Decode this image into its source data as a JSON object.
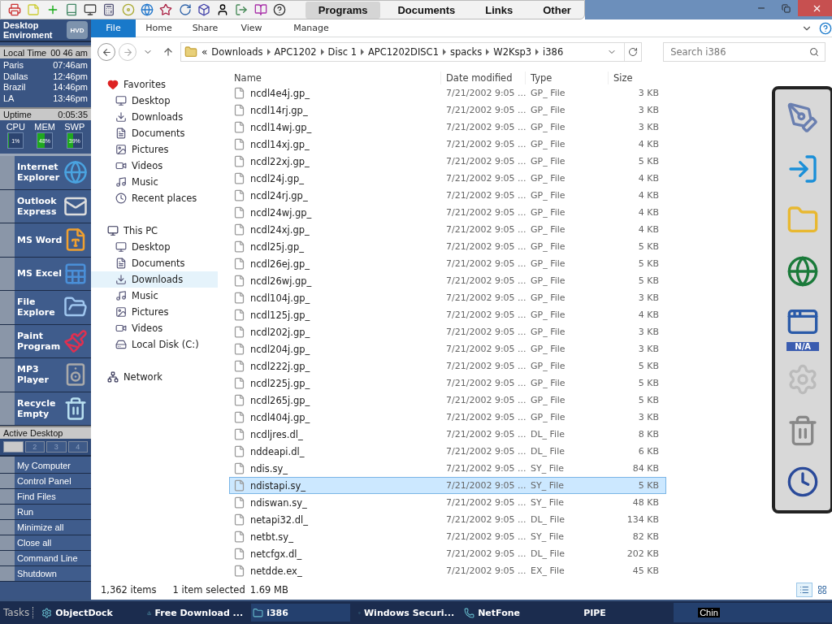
{
  "toolbar": {
    "menu": [
      {
        "label": "Programs",
        "selected": true
      },
      {
        "label": "Documents",
        "selected": false
      },
      {
        "label": "Links",
        "selected": false
      },
      {
        "label": "Other",
        "selected": false
      }
    ]
  },
  "sidebar": {
    "title": "Desktop Enviroment",
    "logo": "HVD",
    "local_time": {
      "label": "Local Time",
      "value": "00 46 am"
    },
    "clocks": [
      {
        "city": "Paris",
        "time": "07:46am"
      },
      {
        "city": "Dallas",
        "time": "12:46pm"
      },
      {
        "city": "Brazil",
        "time": "14:46pm"
      },
      {
        "city": "LA",
        "time": "13:46pm"
      }
    ],
    "uptime": {
      "label": "Uptime",
      "value": "0:05:35"
    },
    "meters": [
      {
        "name": "CPU",
        "reading": "1%",
        "level": 0.01
      },
      {
        "name": "MEM",
        "reading": "48%",
        "level": 0.48
      },
      {
        "name": "SWP",
        "reading": "39%",
        "level": 0.39
      }
    ],
    "launchers": [
      {
        "label": "Internet Explorer"
      },
      {
        "label": "Outlook Express"
      },
      {
        "label": "MS Word"
      },
      {
        "label": "MS Excel"
      },
      {
        "label": "File Explore"
      },
      {
        "label": "Paint Program"
      },
      {
        "label": "MP3 Player"
      },
      {
        "label": "Recycle Empty"
      }
    ],
    "active_desktop": "Active Desktop",
    "pager": [
      {
        "selected": true
      },
      {
        "label": "2",
        "selected": false
      },
      {
        "label": "3",
        "selected": false
      },
      {
        "label": "4",
        "selected": false
      }
    ],
    "menu": [
      "My Computer",
      "Control Panel",
      "Find Files",
      "Run",
      "Minimize all",
      "Close all",
      "Command Line",
      "Shutdown"
    ]
  },
  "ribbon": {
    "tabs": [
      {
        "label": "File",
        "selected": true
      },
      {
        "label": "Home",
        "selected": false
      },
      {
        "label": "Share",
        "selected": false
      },
      {
        "label": "View",
        "selected": false
      },
      {
        "label": "Manage",
        "selected": false
      }
    ]
  },
  "address": {
    "prefix": "«",
    "crumbs": [
      "Downloads",
      "APC1202",
      "Disc 1",
      "APC1202DISC1",
      "spacks",
      "W2Ksp3",
      "i386"
    ],
    "search_placeholder": "Search i386"
  },
  "nav": [
    {
      "label": "Favorites",
      "children": [
        {
          "label": "Desktop",
          "selected": false
        },
        {
          "label": "Downloads",
          "selected": false
        },
        {
          "label": "Documents",
          "selected": false
        },
        {
          "label": "Pictures",
          "selected": false
        },
        {
          "label": "Videos",
          "selected": false
        },
        {
          "label": "Music",
          "selected": false
        },
        {
          "label": "Recent places",
          "selected": false
        }
      ]
    },
    {
      "label": "This PC",
      "children": [
        {
          "label": "Desktop",
          "selected": false
        },
        {
          "label": "Documents",
          "selected": false
        },
        {
          "label": "Downloads",
          "selected": true
        },
        {
          "label": "Music",
          "selected": false
        },
        {
          "label": "Pictures",
          "selected": false
        },
        {
          "label": "Videos",
          "selected": false
        },
        {
          "label": "Local Disk (C:)",
          "selected": false
        }
      ]
    },
    {
      "label": "Network"
    }
  ],
  "table": {
    "columns": [
      "Name",
      "Date modified",
      "Type",
      "Size"
    ],
    "rows": [
      {
        "name": "ncdl4e4j.gp_",
        "date": "7/21/2002 9:05 ...",
        "type": "GP_ File",
        "size": "3 KB",
        "selected": false
      },
      {
        "name": "ncdl14rj.gp_",
        "date": "7/21/2002 9:05 ...",
        "type": "GP_ File",
        "size": "3 KB",
        "selected": false
      },
      {
        "name": "ncdl14wj.gp_",
        "date": "7/21/2002 9:05 ...",
        "type": "GP_ File",
        "size": "3 KB",
        "selected": false
      },
      {
        "name": "ncdl14xj.gp_",
        "date": "7/21/2002 9:05 ...",
        "type": "GP_ File",
        "size": "4 KB",
        "selected": false
      },
      {
        "name": "ncdl22xj.gp_",
        "date": "7/21/2002 9:05 ...",
        "type": "GP_ File",
        "size": "5 KB",
        "selected": false
      },
      {
        "name": "ncdl24j.gp_",
        "date": "7/21/2002 9:05 ...",
        "type": "GP_ File",
        "size": "4 KB",
        "selected": false
      },
      {
        "name": "ncdl24rj.gp_",
        "date": "7/21/2002 9:05 ...",
        "type": "GP_ File",
        "size": "4 KB",
        "selected": false
      },
      {
        "name": "ncdl24wj.gp_",
        "date": "7/21/2002 9:05 ...",
        "type": "GP_ File",
        "size": "4 KB",
        "selected": false
      },
      {
        "name": "ncdl24xj.gp_",
        "date": "7/21/2002 9:05 ...",
        "type": "GP_ File",
        "size": "4 KB",
        "selected": false
      },
      {
        "name": "ncdl25j.gp_",
        "date": "7/21/2002 9:05 ...",
        "type": "GP_ File",
        "size": "5 KB",
        "selected": false
      },
      {
        "name": "ncdl26ej.gp_",
        "date": "7/21/2002 9:05 ...",
        "type": "GP_ File",
        "size": "5 KB",
        "selected": false
      },
      {
        "name": "ncdl26wj.gp_",
        "date": "7/21/2002 9:05 ...",
        "type": "GP_ File",
        "size": "5 KB",
        "selected": false
      },
      {
        "name": "ncdl104j.gp_",
        "date": "7/21/2002 9:05 ...",
        "type": "GP_ File",
        "size": "3 KB",
        "selected": false
      },
      {
        "name": "ncdl125j.gp_",
        "date": "7/21/2002 9:05 ...",
        "type": "GP_ File",
        "size": "4 KB",
        "selected": false
      },
      {
        "name": "ncdl202j.gp_",
        "date": "7/21/2002 9:05 ...",
        "type": "GP_ File",
        "size": "3 KB",
        "selected": false
      },
      {
        "name": "ncdl204j.gp_",
        "date": "7/21/2002 9:05 ...",
        "type": "GP_ File",
        "size": "3 KB",
        "selected": false
      },
      {
        "name": "ncdl222j.gp_",
        "date": "7/21/2002 9:05 ...",
        "type": "GP_ File",
        "size": "5 KB",
        "selected": false
      },
      {
        "name": "ncdl225j.gp_",
        "date": "7/21/2002 9:05 ...",
        "type": "GP_ File",
        "size": "5 KB",
        "selected": false
      },
      {
        "name": "ncdl265j.gp_",
        "date": "7/21/2002 9:05 ...",
        "type": "GP_ File",
        "size": "5 KB",
        "selected": false
      },
      {
        "name": "ncdl404j.gp_",
        "date": "7/21/2002 9:05 ...",
        "type": "GP_ File",
        "size": "3 KB",
        "selected": false
      },
      {
        "name": "ncdljres.dl_",
        "date": "7/21/2002 9:05 ...",
        "type": "DL_ File",
        "size": "8 KB",
        "selected": false
      },
      {
        "name": "nddeapi.dl_",
        "date": "7/21/2002 9:05 ...",
        "type": "DL_ File",
        "size": "6 KB",
        "selected": false
      },
      {
        "name": "ndis.sy_",
        "date": "7/21/2002 9:05 ...",
        "type": "SY_ File",
        "size": "84 KB",
        "selected": false
      },
      {
        "name": "ndistapi.sy_",
        "date": "7/21/2002 9:05 ...",
        "type": "SY_ File",
        "size": "5 KB",
        "selected": true
      },
      {
        "name": "ndiswan.sy_",
        "date": "7/21/2002 9:05 ...",
        "type": "SY_ File",
        "size": "48 KB",
        "selected": false
      },
      {
        "name": "netapi32.dl_",
        "date": "7/21/2002 9:05 ...",
        "type": "DL_ File",
        "size": "134 KB",
        "selected": false
      },
      {
        "name": "netbt.sy_",
        "date": "7/21/2002 9:05 ...",
        "type": "SY_ File",
        "size": "82 KB",
        "selected": false
      },
      {
        "name": "netcfgx.dl_",
        "date": "7/21/2002 9:05 ...",
        "type": "DL_ File",
        "size": "202 KB",
        "selected": false
      },
      {
        "name": "netdde.ex_",
        "date": "7/21/2002 9:05 ...",
        "type": "EX_ File",
        "size": "45 KB",
        "selected": false
      }
    ]
  },
  "status_bar": {
    "items": "1,362 items",
    "selection": "1 item selected",
    "size": "1.69 MB"
  },
  "dock": {
    "badge": "N/A"
  },
  "taskbar": {
    "label": "Tasks",
    "items": [
      {
        "label": "ObjectDock",
        "selected": false
      },
      {
        "label": "Free Download ...",
        "selected": false
      },
      {
        "label": "i386",
        "selected": true
      },
      {
        "label": "Windows Securi...",
        "selected": false
      },
      {
        "label": "NetFone",
        "selected": false
      },
      {
        "label": "PIPE",
        "selected": false
      }
    ],
    "tray": "Chin"
  }
}
